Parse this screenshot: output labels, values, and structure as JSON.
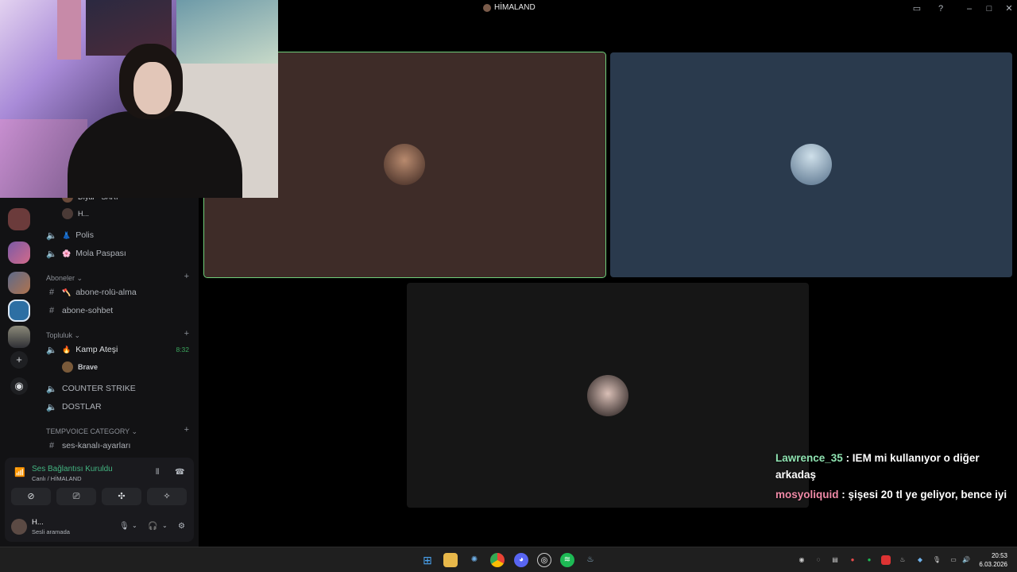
{
  "window": {
    "title": "HİMALAND"
  },
  "sidebar": {
    "partial_user_1": "Dİyar · SARI",
    "partial_user_2": "H...",
    "channels_top": [
      {
        "label": "Polis",
        "emoji": "👗"
      },
      {
        "label": "Mola Paspası",
        "emoji": "🌸"
      }
    ],
    "categories": [
      {
        "name": "Aboneler ⌄",
        "channels": [
          {
            "label": "abone-rolü-alma",
            "emoji": "🪓"
          },
          {
            "label": "abone-sohbet",
            "emoji": ""
          }
        ]
      },
      {
        "name": "Topluluk ⌄",
        "channels": [
          {
            "label": "Kamp Ateşi",
            "emoji": "🔥",
            "timer": "8:32",
            "member": "Brave"
          },
          {
            "label": "COUNTER STRIKE",
            "emoji": ""
          },
          {
            "label": "DOSTLAR",
            "emoji": ""
          }
        ]
      },
      {
        "name": "TEMPVOICE CATEGORY ⌄",
        "channels": [
          {
            "label": "ses-kanalı-ayarları",
            "emoji": ""
          }
        ]
      }
    ]
  },
  "voice_panel": {
    "status": "Ses Bağlantısı Kuruldu",
    "subtitle": "Canlı / HİMALAND",
    "user_name": "H...",
    "user_status": "Sesli aramada"
  },
  "chat": [
    {
      "user": "Lawrence_35",
      "message": " : IEM mi kullanıyor o diğer arkadaş"
    },
    {
      "user": "mosyoliquid",
      "message": " : şişesi 20 tl ye geliyor, bence iyi"
    }
  ],
  "tiles_colors": {
    "tile1": "#3e2c28",
    "tile2": "#2a3a4d",
    "tile3": "#161616",
    "speaking": "#6fcf7a"
  },
  "clock": {
    "time": "20:53",
    "date": "6.03.2026"
  }
}
